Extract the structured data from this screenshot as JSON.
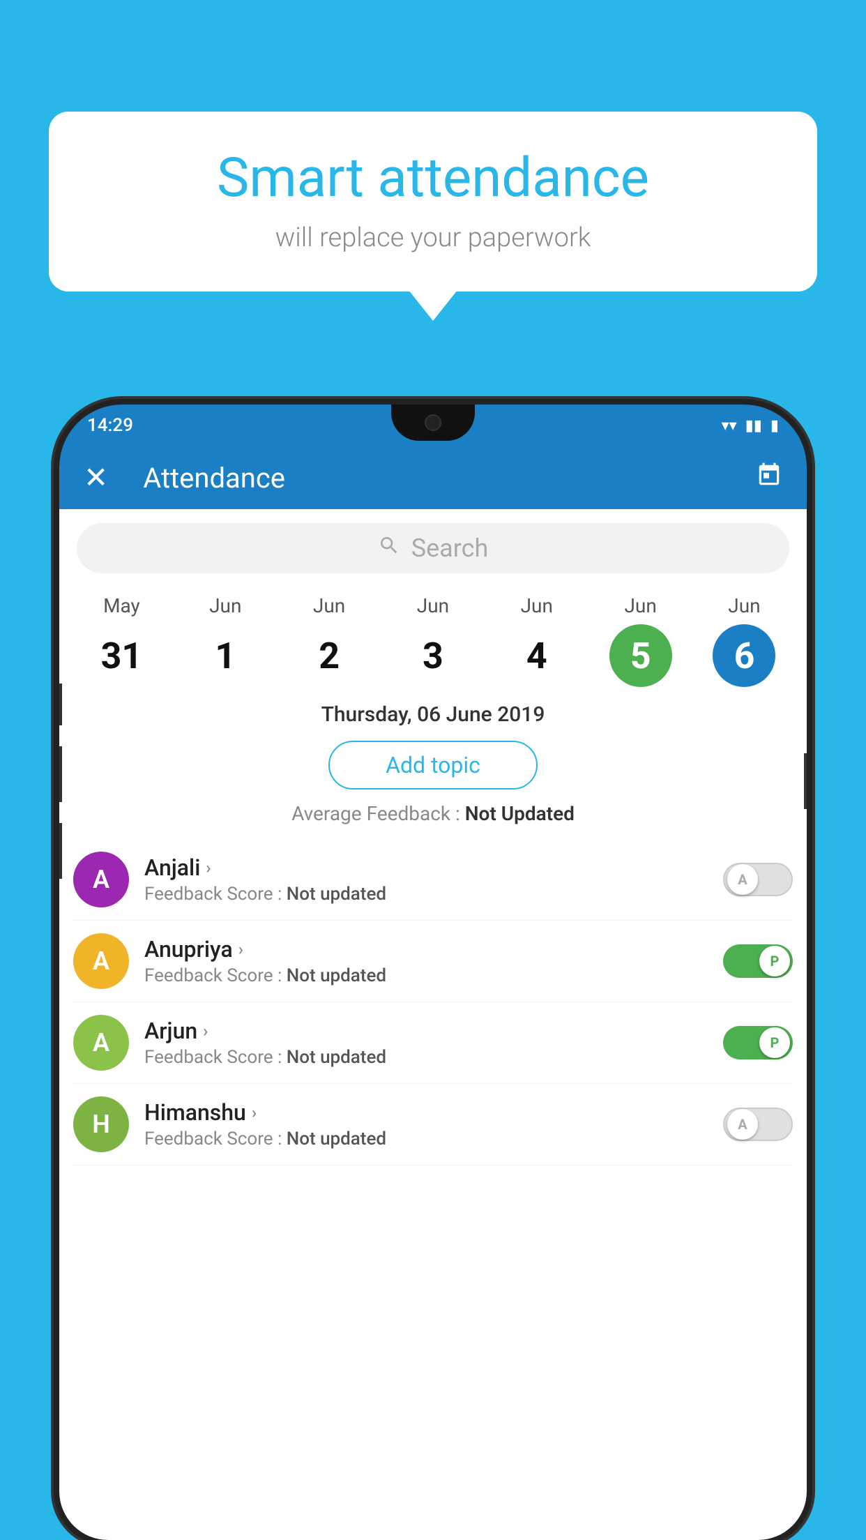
{
  "app": {
    "background_color": "#29b6e8"
  },
  "bubble": {
    "title": "Smart attendance",
    "subtitle": "will replace your paperwork"
  },
  "status_bar": {
    "time": "14:29",
    "wifi_icon": "▼",
    "signal_icon": "◀",
    "battery_icon": "▮"
  },
  "header": {
    "close_icon": "✕",
    "title": "Attendance",
    "calendar_icon": "📅"
  },
  "search": {
    "placeholder": "Search"
  },
  "calendar": {
    "days": [
      {
        "month": "May",
        "date": "31",
        "state": "normal"
      },
      {
        "month": "Jun",
        "date": "1",
        "state": "normal"
      },
      {
        "month": "Jun",
        "date": "2",
        "state": "normal"
      },
      {
        "month": "Jun",
        "date": "3",
        "state": "normal"
      },
      {
        "month": "Jun",
        "date": "4",
        "state": "normal"
      },
      {
        "month": "Jun",
        "date": "5",
        "state": "today"
      },
      {
        "month": "Jun",
        "date": "6",
        "state": "selected"
      }
    ],
    "selected_date_label": "Thursday, 06 June 2019"
  },
  "add_topic": {
    "label": "Add topic"
  },
  "avg_feedback": {
    "label": "Average Feedback : ",
    "value": "Not Updated"
  },
  "students": [
    {
      "name": "Anjali",
      "avatar_letter": "A",
      "avatar_color": "#9c27b0",
      "feedback_label": "Feedback Score : ",
      "feedback_value": "Not updated",
      "toggle_state": "off",
      "toggle_label": "A"
    },
    {
      "name": "Anupriya",
      "avatar_letter": "A",
      "avatar_color": "#f0b429",
      "feedback_label": "Feedback Score : ",
      "feedback_value": "Not updated",
      "toggle_state": "on",
      "toggle_label": "P"
    },
    {
      "name": "Arjun",
      "avatar_letter": "A",
      "avatar_color": "#8bc34a",
      "feedback_label": "Feedback Score : ",
      "feedback_value": "Not updated",
      "toggle_state": "on",
      "toggle_label": "P"
    },
    {
      "name": "Himanshu",
      "avatar_letter": "H",
      "avatar_color": "#7cb342",
      "feedback_label": "Feedback Score : ",
      "feedback_value": "Not updated",
      "toggle_state": "off",
      "toggle_label": "A"
    }
  ]
}
